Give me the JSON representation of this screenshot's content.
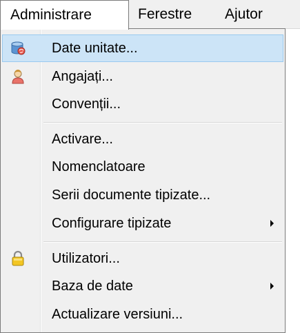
{
  "menubar": {
    "items": [
      {
        "label": "Administrare",
        "active": true
      },
      {
        "label": "Ferestre",
        "active": false
      },
      {
        "label": "Ajutor",
        "active": false
      }
    ]
  },
  "menu": {
    "items": [
      {
        "label": "Date unitate...",
        "icon": "database-globe-icon",
        "highlighted": true
      },
      {
        "label": "Angajați...",
        "icon": "user-icon"
      },
      {
        "label": "Convenții..."
      },
      {
        "label": "Activare..."
      },
      {
        "label": "Nomenclatoare"
      },
      {
        "label": "Serii documente tipizate..."
      },
      {
        "label": "Configurare tipizate",
        "submenu": true
      },
      {
        "label": "Utilizatori...",
        "icon": "padlock-icon"
      },
      {
        "label": "Baza de date",
        "submenu": true
      },
      {
        "label": "Actualizare versiuni..."
      }
    ]
  },
  "colors": {
    "highlight": "#cce4f7",
    "highlight_border": "#99c9ef",
    "menu_background": "#f0f0f0"
  }
}
